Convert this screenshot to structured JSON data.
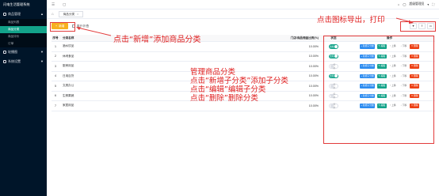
{
  "sidebar": {
    "brand": "闪电生活管理系统",
    "groups": [
      {
        "label": "商品管理",
        "items": [
          "商品列表",
          "商品分类",
          "商品评价",
          "订单"
        ],
        "active_index": 1
      },
      {
        "label": "轮播图"
      },
      {
        "label": "系统设置"
      }
    ]
  },
  "topbar": {
    "user": "超级管理员"
  },
  "tabs": [
    {
      "label": "商品分类"
    }
  ],
  "toolbar": {
    "add_label": "新增",
    "expand_label": "展开/折叠"
  },
  "table": {
    "columns": {
      "no": "序号",
      "name": "分类名称",
      "ratio": "门店/商品佣金比例(%)",
      "status": "状态",
      "ops": "操作"
    },
    "rows": [
      {
        "no": "1",
        "name": "酒水饮品",
        "ratio": "10.00%",
        "status": "on"
      },
      {
        "no": "2",
        "name": "休闲食品",
        "ratio": "10.00%",
        "status": "on"
      },
      {
        "no": "3",
        "name": "厨房用品",
        "ratio": "10.00%",
        "status": "off"
      },
      {
        "no": "4",
        "name": "日用百货",
        "ratio": "10.00%",
        "status": "on"
      },
      {
        "no": "5",
        "name": "文具办公",
        "ratio": "10.00%",
        "status": "off"
      },
      {
        "no": "6",
        "name": "生鲜果蔬",
        "ratio": "10.00%",
        "status": "off"
      },
      {
        "no": "7",
        "name": "家居用品",
        "ratio": "10.00%",
        "status": "off"
      }
    ],
    "switch_on": "启用",
    "switch_off": "停用",
    "ops": {
      "add_child": "新增子分类",
      "edit": "编辑",
      "up": "上移",
      "down": "下移",
      "delete": "删除"
    }
  },
  "annotations": {
    "add": "点击“新增”添加商品分类",
    "export": "点击图标导出，打印",
    "manage": [
      "管理商品分类",
      "点击“新增子分类”添加子分类",
      "点击“编辑”编辑子分类",
      "点击“删除”删除分类"
    ]
  },
  "colors": {
    "sidebar": "#001529",
    "accent": "#13a38a",
    "annotation": "#e23b3b",
    "add_button": "#f7b01f"
  }
}
